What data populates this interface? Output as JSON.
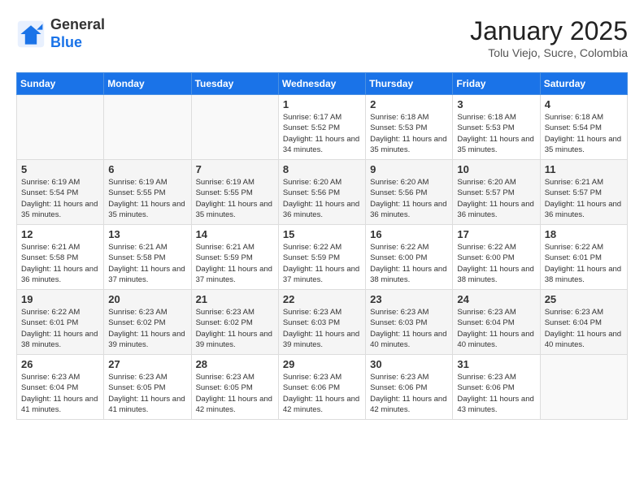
{
  "header": {
    "logo_line1": "General",
    "logo_line2": "Blue",
    "month_title": "January 2025",
    "subtitle": "Tolu Viejo, Sucre, Colombia"
  },
  "days_of_week": [
    "Sunday",
    "Monday",
    "Tuesday",
    "Wednesday",
    "Thursday",
    "Friday",
    "Saturday"
  ],
  "weeks": [
    [
      {
        "day": "",
        "empty": true
      },
      {
        "day": "",
        "empty": true
      },
      {
        "day": "",
        "empty": true
      },
      {
        "day": "1",
        "sunrise": "6:17 AM",
        "sunset": "5:52 PM",
        "daylight": "11 hours and 34 minutes."
      },
      {
        "day": "2",
        "sunrise": "6:18 AM",
        "sunset": "5:53 PM",
        "daylight": "11 hours and 35 minutes."
      },
      {
        "day": "3",
        "sunrise": "6:18 AM",
        "sunset": "5:53 PM",
        "daylight": "11 hours and 35 minutes."
      },
      {
        "day": "4",
        "sunrise": "6:18 AM",
        "sunset": "5:54 PM",
        "daylight": "11 hours and 35 minutes."
      }
    ],
    [
      {
        "day": "5",
        "sunrise": "6:19 AM",
        "sunset": "5:54 PM",
        "daylight": "11 hours and 35 minutes."
      },
      {
        "day": "6",
        "sunrise": "6:19 AM",
        "sunset": "5:55 PM",
        "daylight": "11 hours and 35 minutes."
      },
      {
        "day": "7",
        "sunrise": "6:19 AM",
        "sunset": "5:55 PM",
        "daylight": "11 hours and 35 minutes."
      },
      {
        "day": "8",
        "sunrise": "6:20 AM",
        "sunset": "5:56 PM",
        "daylight": "11 hours and 36 minutes."
      },
      {
        "day": "9",
        "sunrise": "6:20 AM",
        "sunset": "5:56 PM",
        "daylight": "11 hours and 36 minutes."
      },
      {
        "day": "10",
        "sunrise": "6:20 AM",
        "sunset": "5:57 PM",
        "daylight": "11 hours and 36 minutes."
      },
      {
        "day": "11",
        "sunrise": "6:21 AM",
        "sunset": "5:57 PM",
        "daylight": "11 hours and 36 minutes."
      }
    ],
    [
      {
        "day": "12",
        "sunrise": "6:21 AM",
        "sunset": "5:58 PM",
        "daylight": "11 hours and 36 minutes."
      },
      {
        "day": "13",
        "sunrise": "6:21 AM",
        "sunset": "5:58 PM",
        "daylight": "11 hours and 37 minutes."
      },
      {
        "day": "14",
        "sunrise": "6:21 AM",
        "sunset": "5:59 PM",
        "daylight": "11 hours and 37 minutes."
      },
      {
        "day": "15",
        "sunrise": "6:22 AM",
        "sunset": "5:59 PM",
        "daylight": "11 hours and 37 minutes."
      },
      {
        "day": "16",
        "sunrise": "6:22 AM",
        "sunset": "6:00 PM",
        "daylight": "11 hours and 38 minutes."
      },
      {
        "day": "17",
        "sunrise": "6:22 AM",
        "sunset": "6:00 PM",
        "daylight": "11 hours and 38 minutes."
      },
      {
        "day": "18",
        "sunrise": "6:22 AM",
        "sunset": "6:01 PM",
        "daylight": "11 hours and 38 minutes."
      }
    ],
    [
      {
        "day": "19",
        "sunrise": "6:22 AM",
        "sunset": "6:01 PM",
        "daylight": "11 hours and 38 minutes."
      },
      {
        "day": "20",
        "sunrise": "6:23 AM",
        "sunset": "6:02 PM",
        "daylight": "11 hours and 39 minutes."
      },
      {
        "day": "21",
        "sunrise": "6:23 AM",
        "sunset": "6:02 PM",
        "daylight": "11 hours and 39 minutes."
      },
      {
        "day": "22",
        "sunrise": "6:23 AM",
        "sunset": "6:03 PM",
        "daylight": "11 hours and 39 minutes."
      },
      {
        "day": "23",
        "sunrise": "6:23 AM",
        "sunset": "6:03 PM",
        "daylight": "11 hours and 40 minutes."
      },
      {
        "day": "24",
        "sunrise": "6:23 AM",
        "sunset": "6:04 PM",
        "daylight": "11 hours and 40 minutes."
      },
      {
        "day": "25",
        "sunrise": "6:23 AM",
        "sunset": "6:04 PM",
        "daylight": "11 hours and 40 minutes."
      }
    ],
    [
      {
        "day": "26",
        "sunrise": "6:23 AM",
        "sunset": "6:04 PM",
        "daylight": "11 hours and 41 minutes."
      },
      {
        "day": "27",
        "sunrise": "6:23 AM",
        "sunset": "6:05 PM",
        "daylight": "11 hours and 41 minutes."
      },
      {
        "day": "28",
        "sunrise": "6:23 AM",
        "sunset": "6:05 PM",
        "daylight": "11 hours and 42 minutes."
      },
      {
        "day": "29",
        "sunrise": "6:23 AM",
        "sunset": "6:06 PM",
        "daylight": "11 hours and 42 minutes."
      },
      {
        "day": "30",
        "sunrise": "6:23 AM",
        "sunset": "6:06 PM",
        "daylight": "11 hours and 42 minutes."
      },
      {
        "day": "31",
        "sunrise": "6:23 AM",
        "sunset": "6:06 PM",
        "daylight": "11 hours and 43 minutes."
      },
      {
        "day": "",
        "empty": true
      }
    ]
  ]
}
